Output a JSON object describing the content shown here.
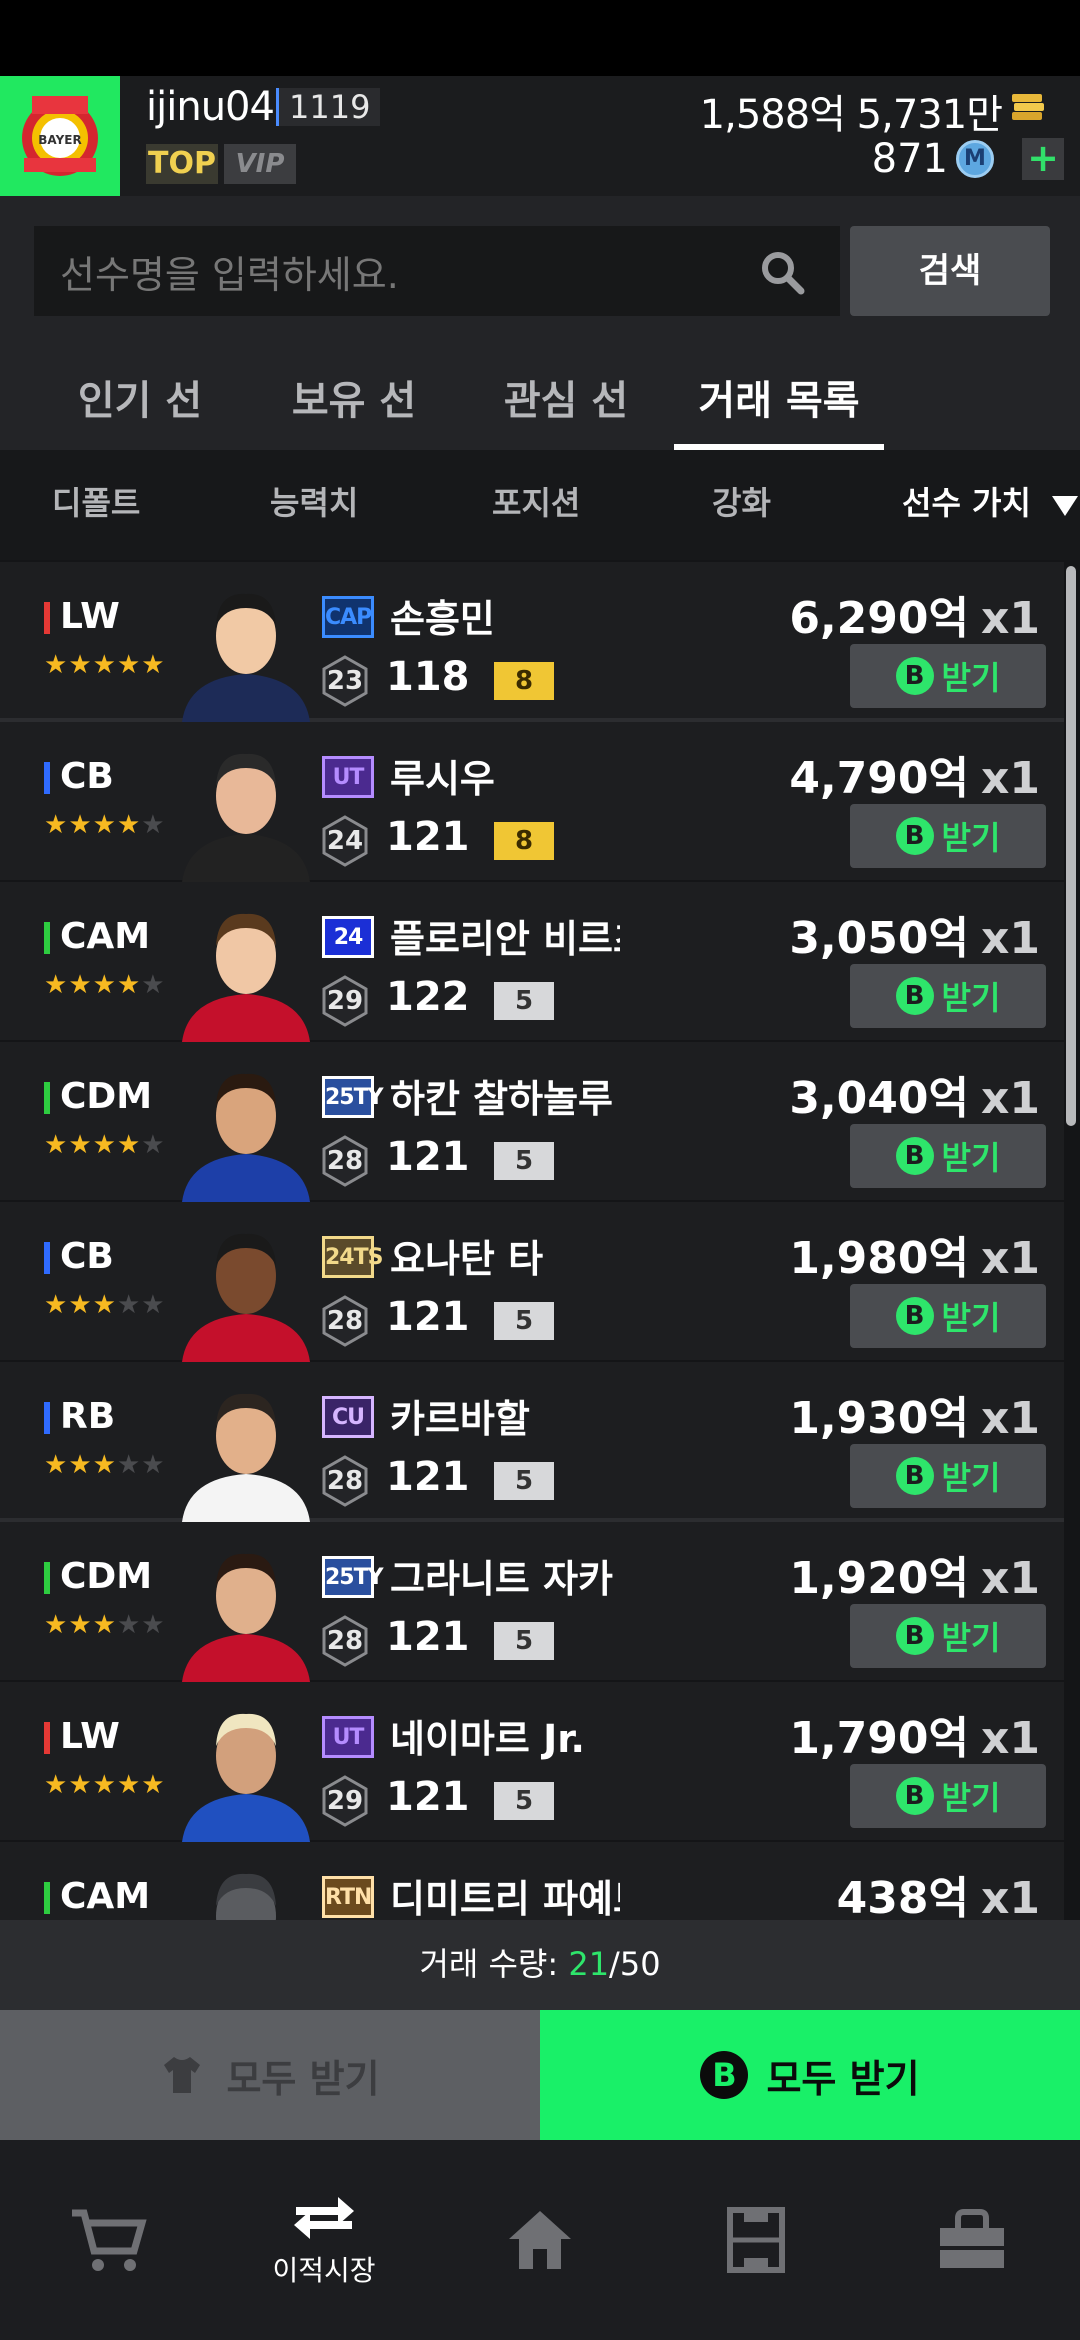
{
  "header": {
    "username": "ijinu04",
    "level": "1119",
    "tag_top": "TOP",
    "tag_vip": "VIP",
    "money": "1,588억 5,731만",
    "mc": "871",
    "mc_icon": "M",
    "plus": "+"
  },
  "search": {
    "placeholder": "선수명을 입력하세요.",
    "button": "검색"
  },
  "tabs": [
    "인기 선수",
    "보유 선수",
    "관심 선수",
    "거래 목록"
  ],
  "active_tab": "거래 목록",
  "sort": [
    "디폴트",
    "능력치",
    "포지션",
    "강화",
    "선수 가치"
  ],
  "active_sort": "선수 가치",
  "players": [
    {
      "pos": "LW",
      "pos_color": "#e53935",
      "stars": 5,
      "season": "CAP",
      "season_color": "#3b8cff",
      "season_bg": "#10336e",
      "name": "손흥민",
      "age": "23",
      "ovr": "118",
      "enh": "8",
      "price": "6,290억",
      "qty": "x1",
      "recv": "받기",
      "b": "B"
    },
    {
      "pos": "CB",
      "pos_color": "#2f6bff",
      "stars": 4,
      "season": "UT",
      "season_color": "#b58cff",
      "season_bg": "#4b2a8f",
      "name": "루시우",
      "age": "24",
      "ovr": "121",
      "enh": "8",
      "price": "4,790억",
      "qty": "x1",
      "recv": "받기",
      "b": "B"
    },
    {
      "pos": "CAM",
      "pos_color": "#2ecc40",
      "stars": 4,
      "season": "24",
      "season_color": "#ffffff",
      "season_bg": "#1b2fd6",
      "name": "플로리안 비르츠",
      "age": "29",
      "ovr": "122",
      "enh": "5",
      "price": "3,050억",
      "qty": "x1",
      "recv": "받기",
      "b": "B"
    },
    {
      "pos": "CDM",
      "pos_color": "#2ecc40",
      "stars": 4,
      "season": "25TY",
      "season_color": "#ffffff",
      "season_bg": "#2a4f9e",
      "name": "하칸 찰하놀루",
      "age": "28",
      "ovr": "121",
      "enh": "5",
      "price": "3,040억",
      "qty": "x1",
      "recv": "받기",
      "b": "B"
    },
    {
      "pos": "CB",
      "pos_color": "#2f6bff",
      "stars": 3,
      "season": "24TS",
      "season_color": "#f2d98a",
      "season_bg": "#5a4a2a",
      "name": "요나탄 타",
      "age": "28",
      "ovr": "121",
      "enh": "5",
      "price": "1,980억",
      "qty": "x1",
      "recv": "받기",
      "b": "B"
    },
    {
      "pos": "RB",
      "pos_color": "#2f6bff",
      "stars": 3,
      "season": "CU",
      "season_color": "#d6b5ff",
      "season_bg": "#3a2468",
      "name": "카르바할",
      "age": "28",
      "ovr": "121",
      "enh": "5",
      "price": "1,930억",
      "qty": "x1",
      "recv": "받기",
      "b": "B"
    },
    {
      "pos": "CDM",
      "pos_color": "#2ecc40",
      "stars": 3,
      "season": "25TY",
      "season_color": "#ffffff",
      "season_bg": "#2a4f9e",
      "name": "그라니트 자카",
      "age": "28",
      "ovr": "121",
      "enh": "5",
      "price": "1,920억",
      "qty": "x1",
      "recv": "받기",
      "b": "B"
    },
    {
      "pos": "LW",
      "pos_color": "#e53935",
      "stars": 5,
      "season": "UT",
      "season_color": "#b58cff",
      "season_bg": "#4b2a8f",
      "name": "네이마르 Jr.",
      "age": "29",
      "ovr": "121",
      "enh": "5",
      "price": "1,790억",
      "qty": "x1",
      "recv": "받기",
      "b": "B"
    },
    {
      "pos": "CAM",
      "pos_color": "#2ecc40",
      "stars": 0,
      "season": "RTN",
      "season_color": "#ffe0a8",
      "season_bg": "#6b4a1e",
      "name": "디미트리 파예트",
      "age": "",
      "ovr": "",
      "enh": "",
      "price": "438억",
      "qty": "x1",
      "recv": "",
      "b": ""
    }
  ],
  "trade_count": {
    "label": "거래 수량: ",
    "current": "21",
    "max": "/50"
  },
  "buttons": {
    "left": "모두 받기",
    "right": "모두 받기",
    "right_icon": "B"
  },
  "nav": [
    {
      "icon": "cart-icon",
      "label": ""
    },
    {
      "icon": "transfer-icon",
      "label": "이적시장"
    },
    {
      "icon": "home-icon",
      "label": ""
    },
    {
      "icon": "squad-icon",
      "label": ""
    },
    {
      "icon": "shop-icon",
      "label": ""
    }
  ]
}
